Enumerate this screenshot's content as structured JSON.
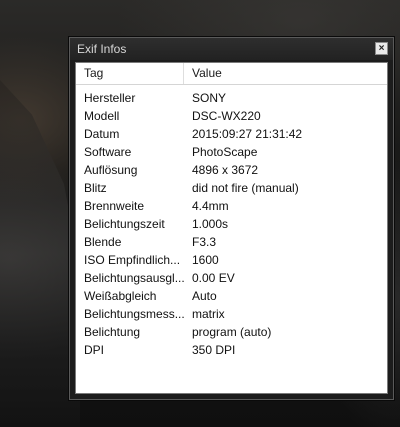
{
  "window": {
    "title": "Exif Infos",
    "close_label": "×"
  },
  "table": {
    "columns": [
      "Tag",
      "Value"
    ],
    "rows": [
      {
        "tag": "Hersteller",
        "value": "SONY"
      },
      {
        "tag": "Modell",
        "value": "DSC-WX220"
      },
      {
        "tag": "Datum",
        "value": "2015:09:27 21:31:42"
      },
      {
        "tag": "Software",
        "value": "PhotoScape"
      },
      {
        "tag": "Auflösung",
        "value": "4896 x 3672"
      },
      {
        "tag": "Blitz",
        "value": "did not fire (manual)"
      },
      {
        "tag": "Brennweite",
        "value": "4.4mm"
      },
      {
        "tag": "Belichtungszeit",
        "value": "1.000s"
      },
      {
        "tag": "Blende",
        "value": "F3.3"
      },
      {
        "tag": "ISO Empfindlich...",
        "value": "1600"
      },
      {
        "tag": "Belichtungsausgl...",
        "value": "0.00 EV"
      },
      {
        "tag": "Weißabgleich",
        "value": "Auto"
      },
      {
        "tag": "Belichtungsmess...",
        "value": "matrix"
      },
      {
        "tag": "Belichtung",
        "value": "program (auto)"
      },
      {
        "tag": "DPI",
        "value": "350 DPI"
      }
    ]
  },
  "colors": {
    "window_background": "#1c1c1c",
    "panel_background": "#ffffff",
    "text": "#111111"
  }
}
